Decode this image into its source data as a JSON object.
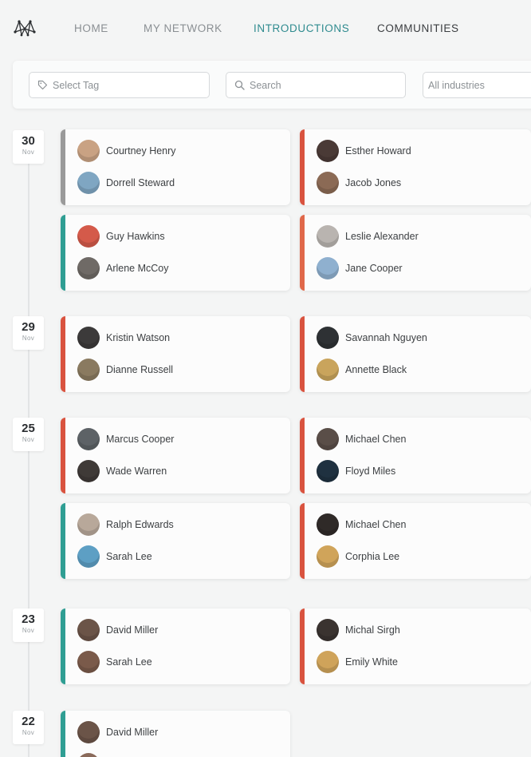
{
  "colors": {
    "teal": "#2f9e93",
    "red": "#d9533f",
    "gray": "#9a9a9a",
    "orange": "#e0684a",
    "active_nav": "#2f8b8f"
  },
  "nav": {
    "items": [
      {
        "label": "HOME",
        "state": "normal"
      },
      {
        "label": "MY NETWORK",
        "state": "normal"
      },
      {
        "label": "INTRODUCTIONS",
        "state": "active"
      },
      {
        "label": "COMMUNITIES",
        "state": "dark"
      }
    ]
  },
  "filters": {
    "tag_placeholder": "Select Tag",
    "search_placeholder": "Search",
    "industries_value": "All industries"
  },
  "groups": [
    {
      "day": "30",
      "month": "Nov",
      "cards": [
        {
          "accent": "gray",
          "people": [
            {
              "name": "Courtney Henry",
              "avatar": "#c9a283"
            },
            {
              "name": "Dorrell Steward",
              "avatar": "#7fa6c2"
            }
          ]
        },
        {
          "accent": "red",
          "people": [
            {
              "name": "Esther Howard",
              "avatar": "#4a3a36"
            },
            {
              "name": "Jacob Jones",
              "avatar": "#8b6a55"
            }
          ]
        },
        {
          "accent": "teal",
          "people": [
            {
              "name": "Guy Hawkins",
              "avatar": "#d45a4a"
            },
            {
              "name": "Arlene McCoy",
              "avatar": "#6f6a66"
            }
          ]
        },
        {
          "accent": "orange",
          "people": [
            {
              "name": "Leslie Alexander",
              "avatar": "#b9b4b0"
            },
            {
              "name": "Jane Cooper",
              "avatar": "#8fb0cf"
            }
          ]
        }
      ]
    },
    {
      "day": "29",
      "month": "Nov",
      "cards": [
        {
          "accent": "red",
          "people": [
            {
              "name": "Kristin Watson",
              "avatar": "#3c3a3a"
            },
            {
              "name": "Dianne Russell",
              "avatar": "#8a7a60"
            }
          ]
        },
        {
          "accent": "red",
          "people": [
            {
              "name": "Savannah Nguyen",
              "avatar": "#2e3134"
            },
            {
              "name": "Annette Black",
              "avatar": "#c9a45c"
            }
          ]
        }
      ]
    },
    {
      "day": "25",
      "month": "Nov",
      "cards": [
        {
          "accent": "red",
          "people": [
            {
              "name": "Marcus Cooper",
              "avatar": "#5d6266"
            },
            {
              "name": "Wade Warren",
              "avatar": "#3f3a37"
            }
          ]
        },
        {
          "accent": "red",
          "people": [
            {
              "name": "Michael Chen",
              "avatar": "#5a4e48"
            },
            {
              "name": "Floyd Miles",
              "avatar": "#1f3140"
            }
          ]
        },
        {
          "accent": "teal",
          "people": [
            {
              "name": "Ralph Edwards",
              "avatar": "#b8a89a"
            },
            {
              "name": "Sarah Lee",
              "avatar": "#5d9fc4"
            }
          ]
        },
        {
          "accent": "red",
          "people": [
            {
              "name": "Michael Chen",
              "avatar": "#2f2a28"
            },
            {
              "name": "Corphia Lee",
              "avatar": "#d0a45a"
            }
          ]
        }
      ]
    },
    {
      "day": "23",
      "month": "Nov",
      "cards": [
        {
          "accent": "teal",
          "people": [
            {
              "name": "David Miller",
              "avatar": "#6b5448"
            },
            {
              "name": "Sarah Lee",
              "avatar": "#7a5a4a"
            }
          ]
        },
        {
          "accent": "red",
          "people": [
            {
              "name": "Michal Sirgh",
              "avatar": "#3a3330"
            },
            {
              "name": "Emily White",
              "avatar": "#cfa35a"
            }
          ]
        }
      ]
    },
    {
      "day": "22",
      "month": "Nov",
      "cards": [
        {
          "accent": "teal",
          "people": [
            {
              "name": "David Miller",
              "avatar": "#6b5448"
            },
            {
              "name": "",
              "avatar": "#8a6a5a"
            }
          ]
        }
      ]
    }
  ]
}
